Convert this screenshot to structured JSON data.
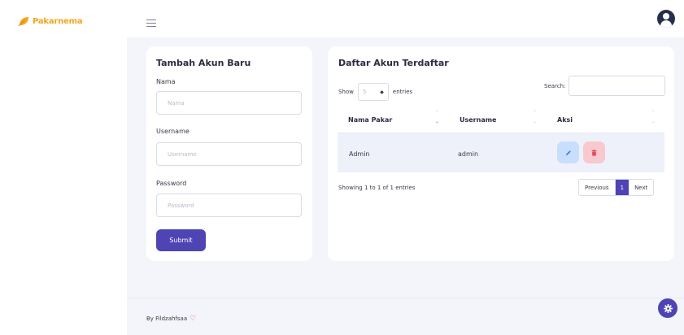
{
  "brand": {
    "name": "Pakarnema",
    "color": "#f4a51c"
  },
  "topbar": {
    "menu_icon": "hamburger-icon",
    "avatar_icon": "user-avatar-icon"
  },
  "form": {
    "title": "Tambah Akun Baru",
    "fields": [
      {
        "label": "Nama",
        "placeholder": "Nama",
        "value": ""
      },
      {
        "label": "Username",
        "placeholder": "Username",
        "value": ""
      },
      {
        "label": "Password",
        "placeholder": "Password",
        "value": ""
      }
    ],
    "submit_label": "Submit"
  },
  "table": {
    "title": "Daftar Akun Terdaftar",
    "show_label": "Show",
    "page_size": "5",
    "entries_label": "entries",
    "search_label": "Search:",
    "search_value": "",
    "columns": [
      "Nama Pakar",
      "Username",
      "Aksi"
    ],
    "rows": [
      {
        "nama_pakar": "Admin",
        "username": "admin",
        "actions": [
          "edit-icon",
          "trash-icon"
        ]
      }
    ],
    "info": "Showing 1 to 1 of 1 entries",
    "pagination": {
      "previous": "Previous",
      "current": "1",
      "next": "Next"
    }
  },
  "footer": {
    "text": "By Fildzahfsaa",
    "heart_icon": "heart-icon"
  },
  "fab": {
    "icon": "gear-icon"
  },
  "colors": {
    "primary": "#4e44b4",
    "edit_bg": "#c9defc",
    "delete_bg": "#f8c9ce",
    "page_bg": "#f3f5fa"
  }
}
